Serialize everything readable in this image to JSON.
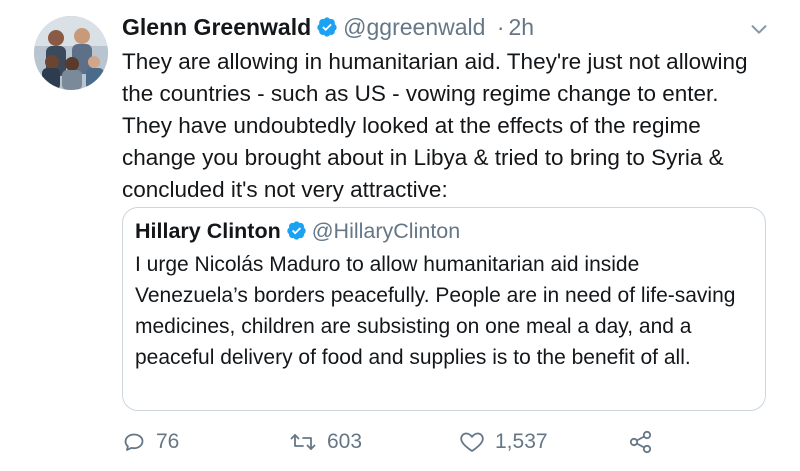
{
  "tweet": {
    "author_name": "Glenn Greenwald",
    "author_handle": "@ggreenwald",
    "separator": "·",
    "time": "2h",
    "text": "They are allowing in humanitarian aid. They're just not allowing the countries - such as US - vowing regime change to enter. They have undoubtedly looked at the effects of the regime change you brought about in Libya & tried to bring to Syria & concluded it's not very attractive:"
  },
  "quoted": {
    "author_name": "Hillary Clinton",
    "author_handle": "@HillaryClinton",
    "text": "I urge Nicolás Maduro to allow humanitarian aid inside Venezuela’s borders peacefully. People are in need of life-saving medicines, children are subsisting on one meal a day, and a peaceful delivery of food and supplies is to the benefit of all."
  },
  "actions": {
    "replies": "76",
    "retweets": "603",
    "likes": "1,537"
  },
  "icons": {
    "verified": "verified-badge-icon",
    "caret": "chevron-down-icon",
    "reply": "reply-icon",
    "retweet": "retweet-icon",
    "like": "heart-icon",
    "share": "share-icon"
  },
  "colors": {
    "verified": "#1da1f2",
    "secondary_text": "#657786",
    "border": "#ccd6dd"
  }
}
